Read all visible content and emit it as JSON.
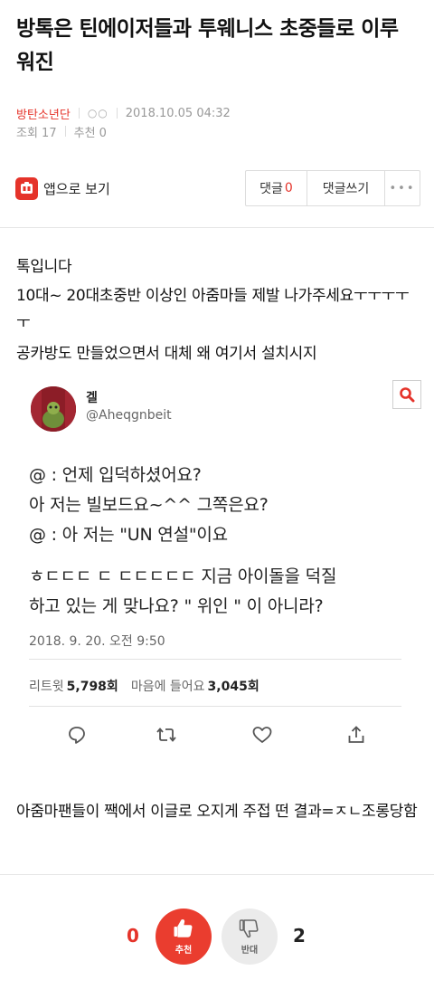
{
  "post": {
    "title": "방톡은 틴에이저들과 투웨니스 초중들로 이루워진",
    "author": "방탄소년단",
    "level": "○○",
    "date": "2018.10.05 04:32",
    "views": "조회 17",
    "recommends": "추천 0"
  },
  "toolbar": {
    "app_view": "앱으로 보기",
    "comments_label": "댓글",
    "comments_count": "0",
    "write_comment": "댓글쓰기",
    "more": "•••"
  },
  "content": {
    "paragraphs": [
      "톡입니다",
      "10대~ 20대초중반 이상인 아줌마들 제발 나가주세요ㅜㅜㅜㅜㅜ",
      "공카방도 만들었으면서 대체 왜 여기서 설치시지"
    ],
    "closing": "아줌마팬들이 짹에서 이글로 오지게 주접 떤 결과=ㅈㄴ조롱당함"
  },
  "tweet": {
    "name": "겔",
    "handle": "@Aheqgnbeit",
    "lines": [
      "@ : 언제 입덕하셨어요?",
      "아 저는 빌보드요~^^ 그쪽은요?",
      "@ : 아 저는 \"UN 연설\"이요",
      "ㅎㄷㄷㄷ ㄷ ㄷㄷㄷㄷㄷ 지금 아이돌을 덕질",
      "하고 있는 게 맞나요? \" 위인 \" 이 아니라?"
    ],
    "timestamp": "2018. 9. 20. 오전 9:50",
    "retweets_label": "리트윗",
    "retweets": "5,798회",
    "likes_label": "마음에 들어요",
    "likes": "3,045회"
  },
  "votes": {
    "up_count": "0",
    "up_label": "추천",
    "down_label": "반대",
    "down_count": "2"
  },
  "colors": {
    "accent": "#e5332a",
    "up_button": "#ea3d2f",
    "down_button": "#ebebeb"
  }
}
